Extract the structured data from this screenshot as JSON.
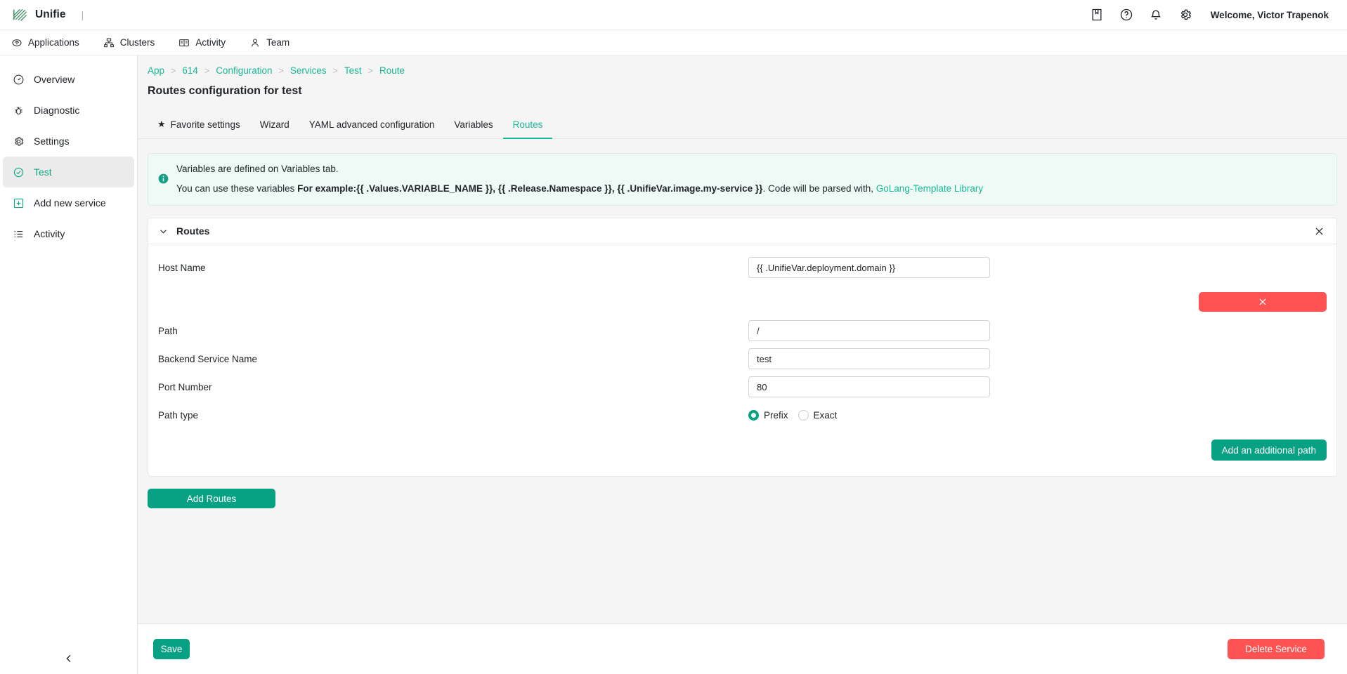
{
  "topbar": {
    "brand_name": "Unifie",
    "brand_separator": "|",
    "welcome": "Welcome, Victor Trapenok",
    "icons": [
      "book-icon",
      "help-circle-icon",
      "bell-icon",
      "gear-icon"
    ]
  },
  "navbar": {
    "items": [
      {
        "label": "Applications",
        "icon": "applications-icon"
      },
      {
        "label": "Clusters",
        "icon": "clusters-icon"
      },
      {
        "label": "Activity",
        "icon": "activity-book-icon"
      },
      {
        "label": "Team",
        "icon": "team-person-icon"
      }
    ]
  },
  "sidebar": {
    "items": [
      {
        "label": "Overview",
        "icon": "gauge-icon",
        "active": false
      },
      {
        "label": "Diagnostic",
        "icon": "bug-icon",
        "active": false
      },
      {
        "label": "Settings",
        "icon": "gear-icon",
        "active": false
      },
      {
        "label": "Test",
        "icon": "check-circle-icon",
        "active": true
      },
      {
        "label": "Add new service",
        "icon": "plus-box-icon",
        "active": false
      },
      {
        "label": "Activity",
        "icon": "list-icon",
        "active": false
      }
    ],
    "collapse_icon": "chevron-left-icon"
  },
  "breadcrumb": [
    {
      "label": "App"
    },
    {
      "label": "614"
    },
    {
      "label": "Configuration"
    },
    {
      "label": "Services"
    },
    {
      "label": "Test"
    },
    {
      "label": "Route"
    }
  ],
  "breadcrumb_separator": ">",
  "page_title": "Routes configuration for test",
  "tabs": [
    {
      "label": "Favorite settings",
      "icon": "star-icon",
      "active": false
    },
    {
      "label": "Wizard",
      "active": false
    },
    {
      "label": "YAML advanced configuration",
      "active": false
    },
    {
      "label": "Variables",
      "active": false
    },
    {
      "label": "Routes",
      "active": true
    }
  ],
  "info_banner": {
    "icon": "info-icon",
    "line1": "Variables are defined on Variables tab.",
    "line2_prefix": "You can use these variables ",
    "line2_bold": "For example:{{ .Values.VARIABLE_NAME }}, {{ .Release.Namespace }}, {{ .UnifieVar.image.my-service }}",
    "line2_suffix": ". Code will be parsed with,",
    "link_label": "GoLang-Template Library"
  },
  "panel": {
    "title": "Routes",
    "collapse_icon": "chevron-down-icon",
    "close_icon": "close-icon",
    "fields": [
      {
        "label": "Host Name",
        "value": "{{ .UnifieVar.deployment.domain }}",
        "placeholder": ""
      },
      {
        "label": "Path",
        "value": "/",
        "placeholder": ""
      },
      {
        "label": "Backend Service Name",
        "value": "test",
        "placeholder": ""
      },
      {
        "label": "Port Number",
        "value": "80",
        "placeholder": ""
      }
    ],
    "path_type": {
      "label": "Path type",
      "options": [
        {
          "label": "Prefix",
          "selected": true
        },
        {
          "label": "Exact",
          "selected": false
        }
      ]
    },
    "remove_host_button": {
      "icon": "close-icon",
      "label": ""
    },
    "add_path_button": "Add an additional path"
  },
  "add_routes_button": "Add Routes",
  "footer": {
    "save_label": "Save",
    "delete_label": "Delete Service"
  },
  "colors": {
    "accent": "#17b798",
    "accent_button": "#09a184",
    "danger": "#ff5252",
    "banner_bg": "#effaf6",
    "page_bg": "#f5f5f5"
  }
}
